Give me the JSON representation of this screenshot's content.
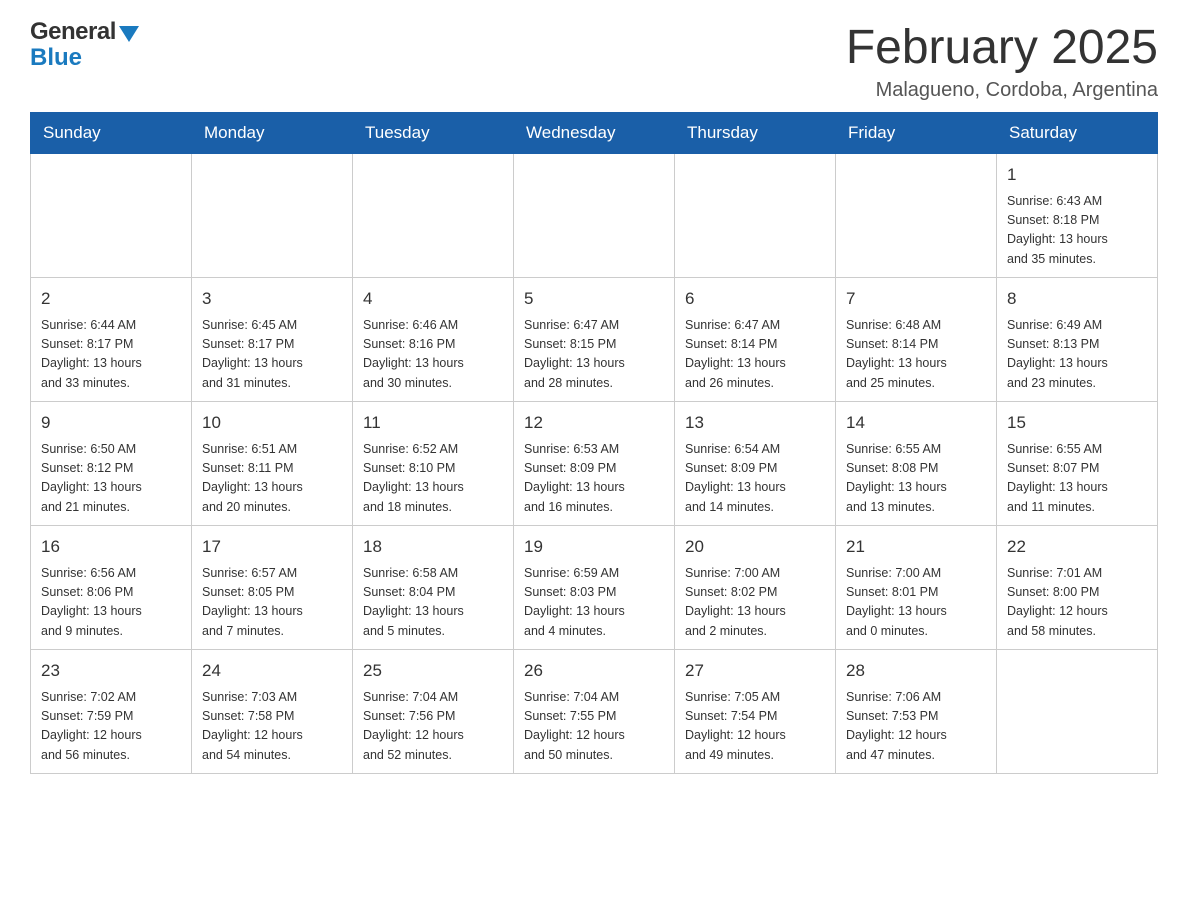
{
  "header": {
    "logo": {
      "general": "General",
      "blue": "Blue"
    },
    "title": "February 2025",
    "location": "Malagueno, Cordoba, Argentina"
  },
  "days_of_week": [
    "Sunday",
    "Monday",
    "Tuesday",
    "Wednesday",
    "Thursday",
    "Friday",
    "Saturday"
  ],
  "weeks": [
    [
      {
        "day": "",
        "info": ""
      },
      {
        "day": "",
        "info": ""
      },
      {
        "day": "",
        "info": ""
      },
      {
        "day": "",
        "info": ""
      },
      {
        "day": "",
        "info": ""
      },
      {
        "day": "",
        "info": ""
      },
      {
        "day": "1",
        "info": "Sunrise: 6:43 AM\nSunset: 8:18 PM\nDaylight: 13 hours\nand 35 minutes."
      }
    ],
    [
      {
        "day": "2",
        "info": "Sunrise: 6:44 AM\nSunset: 8:17 PM\nDaylight: 13 hours\nand 33 minutes."
      },
      {
        "day": "3",
        "info": "Sunrise: 6:45 AM\nSunset: 8:17 PM\nDaylight: 13 hours\nand 31 minutes."
      },
      {
        "day": "4",
        "info": "Sunrise: 6:46 AM\nSunset: 8:16 PM\nDaylight: 13 hours\nand 30 minutes."
      },
      {
        "day": "5",
        "info": "Sunrise: 6:47 AM\nSunset: 8:15 PM\nDaylight: 13 hours\nand 28 minutes."
      },
      {
        "day": "6",
        "info": "Sunrise: 6:47 AM\nSunset: 8:14 PM\nDaylight: 13 hours\nand 26 minutes."
      },
      {
        "day": "7",
        "info": "Sunrise: 6:48 AM\nSunset: 8:14 PM\nDaylight: 13 hours\nand 25 minutes."
      },
      {
        "day": "8",
        "info": "Sunrise: 6:49 AM\nSunset: 8:13 PM\nDaylight: 13 hours\nand 23 minutes."
      }
    ],
    [
      {
        "day": "9",
        "info": "Sunrise: 6:50 AM\nSunset: 8:12 PM\nDaylight: 13 hours\nand 21 minutes."
      },
      {
        "day": "10",
        "info": "Sunrise: 6:51 AM\nSunset: 8:11 PM\nDaylight: 13 hours\nand 20 minutes."
      },
      {
        "day": "11",
        "info": "Sunrise: 6:52 AM\nSunset: 8:10 PM\nDaylight: 13 hours\nand 18 minutes."
      },
      {
        "day": "12",
        "info": "Sunrise: 6:53 AM\nSunset: 8:09 PM\nDaylight: 13 hours\nand 16 minutes."
      },
      {
        "day": "13",
        "info": "Sunrise: 6:54 AM\nSunset: 8:09 PM\nDaylight: 13 hours\nand 14 minutes."
      },
      {
        "day": "14",
        "info": "Sunrise: 6:55 AM\nSunset: 8:08 PM\nDaylight: 13 hours\nand 13 minutes."
      },
      {
        "day": "15",
        "info": "Sunrise: 6:55 AM\nSunset: 8:07 PM\nDaylight: 13 hours\nand 11 minutes."
      }
    ],
    [
      {
        "day": "16",
        "info": "Sunrise: 6:56 AM\nSunset: 8:06 PM\nDaylight: 13 hours\nand 9 minutes."
      },
      {
        "day": "17",
        "info": "Sunrise: 6:57 AM\nSunset: 8:05 PM\nDaylight: 13 hours\nand 7 minutes."
      },
      {
        "day": "18",
        "info": "Sunrise: 6:58 AM\nSunset: 8:04 PM\nDaylight: 13 hours\nand 5 minutes."
      },
      {
        "day": "19",
        "info": "Sunrise: 6:59 AM\nSunset: 8:03 PM\nDaylight: 13 hours\nand 4 minutes."
      },
      {
        "day": "20",
        "info": "Sunrise: 7:00 AM\nSunset: 8:02 PM\nDaylight: 13 hours\nand 2 minutes."
      },
      {
        "day": "21",
        "info": "Sunrise: 7:00 AM\nSunset: 8:01 PM\nDaylight: 13 hours\nand 0 minutes."
      },
      {
        "day": "22",
        "info": "Sunrise: 7:01 AM\nSunset: 8:00 PM\nDaylight: 12 hours\nand 58 minutes."
      }
    ],
    [
      {
        "day": "23",
        "info": "Sunrise: 7:02 AM\nSunset: 7:59 PM\nDaylight: 12 hours\nand 56 minutes."
      },
      {
        "day": "24",
        "info": "Sunrise: 7:03 AM\nSunset: 7:58 PM\nDaylight: 12 hours\nand 54 minutes."
      },
      {
        "day": "25",
        "info": "Sunrise: 7:04 AM\nSunset: 7:56 PM\nDaylight: 12 hours\nand 52 minutes."
      },
      {
        "day": "26",
        "info": "Sunrise: 7:04 AM\nSunset: 7:55 PM\nDaylight: 12 hours\nand 50 minutes."
      },
      {
        "day": "27",
        "info": "Sunrise: 7:05 AM\nSunset: 7:54 PM\nDaylight: 12 hours\nand 49 minutes."
      },
      {
        "day": "28",
        "info": "Sunrise: 7:06 AM\nSunset: 7:53 PM\nDaylight: 12 hours\nand 47 minutes."
      },
      {
        "day": "",
        "info": ""
      }
    ]
  ]
}
